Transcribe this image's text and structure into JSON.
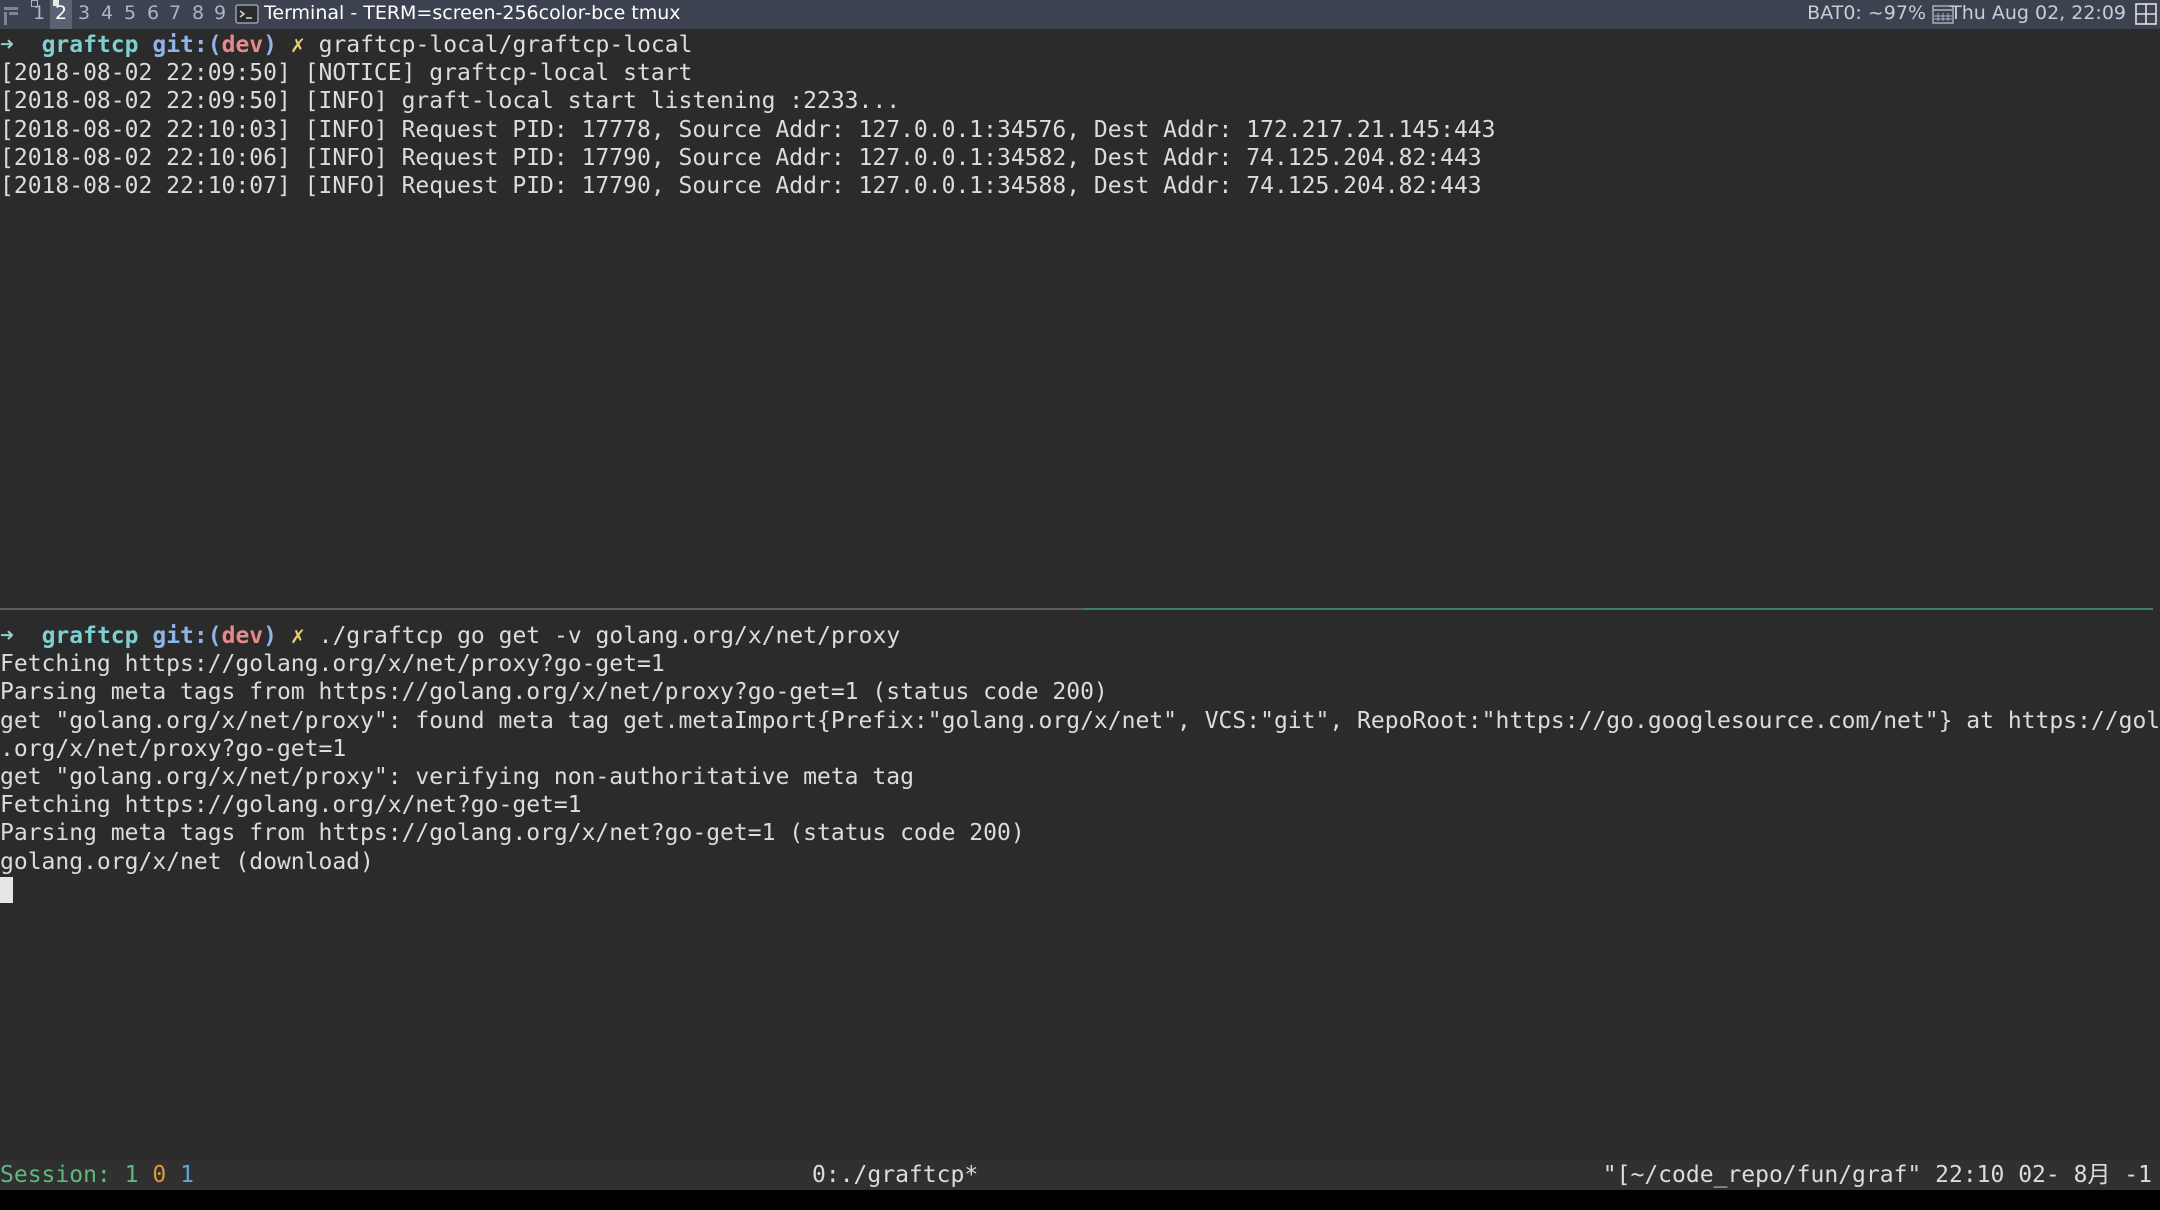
{
  "topbar": {
    "workspaces": [
      "1",
      "2",
      "3",
      "4",
      "5",
      "6",
      "7",
      "8",
      "9"
    ],
    "active_workspace": "2",
    "window_title": "Terminal - TERM=screen-256color-bce tmux",
    "battery": "BAT0: ~97%",
    "clock": "Thu Aug 02, 22:09",
    "icons": [
      "layout-icon",
      "terminal-app-icon",
      "calendar-icon",
      "grid-icon"
    ]
  },
  "pane_top": {
    "prompt": {
      "arrow": "➜",
      "dir": "graftcp",
      "git_prefix": "git:(",
      "branch": "dev",
      "git_suffix": ")",
      "dirty": "✗",
      "command": "graftcp-local/graftcp-local"
    },
    "lines": [
      "[2018-08-02 22:09:50] [NOTICE] graftcp-local start",
      "[2018-08-02 22:09:50] [INFO] graft-local start listening :2233...",
      "[2018-08-02 22:10:03] [INFO] Request PID: 17778, Source Addr: 127.0.0.1:34576, Dest Addr: 172.217.21.145:443",
      "[2018-08-02 22:10:06] [INFO] Request PID: 17790, Source Addr: 127.0.0.1:34582, Dest Addr: 74.125.204.82:443",
      "[2018-08-02 22:10:07] [INFO] Request PID: 17790, Source Addr: 127.0.0.1:34588, Dest Addr: 74.125.204.82:443"
    ]
  },
  "pane_bottom": {
    "prompt": {
      "arrow": "➜",
      "dir": "graftcp",
      "git_prefix": "git:(",
      "branch": "dev",
      "git_suffix": ")",
      "dirty": "✗",
      "command": "./graftcp go get -v golang.org/x/net/proxy"
    },
    "lines": [
      "Fetching https://golang.org/x/net/proxy?go-get=1",
      "Parsing meta tags from https://golang.org/x/net/proxy?go-get=1 (status code 200)",
      "get \"golang.org/x/net/proxy\": found meta tag get.metaImport{Prefix:\"golang.org/x/net\", VCS:\"git\", RepoRoot:\"https://go.googlesource.com/net\"} at https://golang",
      ".org/x/net/proxy?go-get=1",
      "get \"golang.org/x/net/proxy\": verifying non-authoritative meta tag",
      "Fetching https://golang.org/x/net?go-get=1",
      "Parsing meta tags from https://golang.org/x/net?go-get=1 (status code 200)",
      "golang.org/x/net (download)"
    ]
  },
  "tmux": {
    "session_label": "Session: ",
    "session_a": "1",
    "session_b": "0",
    "session_c": "1",
    "window": "0:./graftcp*",
    "right": "\"[~/code_repo/fun/graf\" 22:10 02- 8月 -1"
  }
}
